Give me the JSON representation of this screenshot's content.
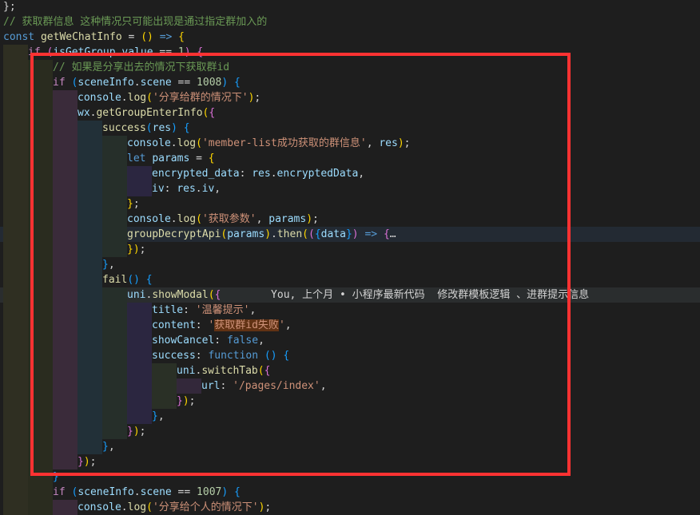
{
  "lines": [
    {
      "indent": 0,
      "cls": "",
      "tokens": [
        {
          "t": "pun",
          "s": "};"
        }
      ]
    },
    {
      "indent": 0,
      "cls": "",
      "tokens": [
        {
          "t": "cmt",
          "s": "// 获取群信息 这种情况只可能出现是通过指定群加入的"
        }
      ]
    },
    {
      "indent": 0,
      "cls": "",
      "tokens": [
        {
          "t": "kw",
          "s": "const "
        },
        {
          "t": "fn",
          "s": "getWeChatInfo"
        },
        {
          "t": "pun",
          "s": " = "
        },
        {
          "t": "br1",
          "s": "()"
        },
        {
          "t": "pun",
          "s": " "
        },
        {
          "t": "kw",
          "s": "=>"
        },
        {
          "t": "pun",
          "s": " "
        },
        {
          "t": "br1",
          "s": "{"
        }
      ]
    },
    {
      "indent": 1,
      "cls": "",
      "tokens": [
        {
          "t": "ctl",
          "s": "if "
        },
        {
          "t": "br2",
          "s": "("
        },
        {
          "t": "var",
          "s": "isGetGroup"
        },
        {
          "t": "pun",
          "s": "."
        },
        {
          "t": "var",
          "s": "value"
        },
        {
          "t": "pun",
          "s": " == "
        },
        {
          "t": "num",
          "s": "1"
        },
        {
          "t": "br2",
          "s": ")"
        },
        {
          "t": "pun",
          "s": " "
        },
        {
          "t": "br2",
          "s": "{"
        }
      ]
    },
    {
      "indent": 2,
      "cls": "",
      "tokens": [
        {
          "t": "cmt",
          "s": "// 如果是分享出去的情况下获取群id"
        }
      ]
    },
    {
      "indent": 2,
      "cls": "",
      "tokens": [
        {
          "t": "ctl",
          "s": "if "
        },
        {
          "t": "br3",
          "s": "("
        },
        {
          "t": "var",
          "s": "sceneInfo"
        },
        {
          "t": "pun",
          "s": "."
        },
        {
          "t": "var",
          "s": "scene"
        },
        {
          "t": "pun",
          "s": " == "
        },
        {
          "t": "num",
          "s": "1008"
        },
        {
          "t": "br3",
          "s": ")"
        },
        {
          "t": "pun",
          "s": " "
        },
        {
          "t": "br3",
          "s": "{"
        }
      ]
    },
    {
      "indent": 3,
      "cls": "",
      "tokens": [
        {
          "t": "var",
          "s": "console"
        },
        {
          "t": "pun",
          "s": "."
        },
        {
          "t": "fn",
          "s": "log"
        },
        {
          "t": "br1",
          "s": "("
        },
        {
          "t": "str",
          "s": "'分享给群的情况下'"
        },
        {
          "t": "br1",
          "s": ")"
        },
        {
          "t": "pun",
          "s": ";"
        }
      ]
    },
    {
      "indent": 3,
      "cls": "",
      "tokens": [
        {
          "t": "var",
          "s": "wx"
        },
        {
          "t": "pun",
          "s": "."
        },
        {
          "t": "fn",
          "s": "getGroupEnterInfo"
        },
        {
          "t": "br1",
          "s": "("
        },
        {
          "t": "br2",
          "s": "{"
        }
      ]
    },
    {
      "indent": 4,
      "cls": "",
      "tokens": [
        {
          "t": "fn",
          "s": "success"
        },
        {
          "t": "br3",
          "s": "("
        },
        {
          "t": "var",
          "s": "res"
        },
        {
          "t": "br3",
          "s": ")"
        },
        {
          "t": "pun",
          "s": " "
        },
        {
          "t": "br3",
          "s": "{"
        }
      ]
    },
    {
      "indent": 5,
      "cls": "",
      "tokens": [
        {
          "t": "var",
          "s": "console"
        },
        {
          "t": "pun",
          "s": "."
        },
        {
          "t": "fn",
          "s": "log"
        },
        {
          "t": "br1",
          "s": "("
        },
        {
          "t": "str",
          "s": "'member-list成功获取的群信息'"
        },
        {
          "t": "pun",
          "s": ", "
        },
        {
          "t": "var",
          "s": "res"
        },
        {
          "t": "br1",
          "s": ")"
        },
        {
          "t": "pun",
          "s": ";"
        }
      ]
    },
    {
      "indent": 5,
      "cls": "",
      "tokens": [
        {
          "t": "kw",
          "s": "let "
        },
        {
          "t": "var",
          "s": "params"
        },
        {
          "t": "pun",
          "s": " = "
        },
        {
          "t": "br1",
          "s": "{"
        }
      ]
    },
    {
      "indent": 6,
      "cls": "",
      "tokens": [
        {
          "t": "var",
          "s": "encrypted_data"
        },
        {
          "t": "pun",
          "s": ": "
        },
        {
          "t": "var",
          "s": "res"
        },
        {
          "t": "pun",
          "s": "."
        },
        {
          "t": "var",
          "s": "encryptedData"
        },
        {
          "t": "pun",
          "s": ","
        }
      ]
    },
    {
      "indent": 6,
      "cls": "",
      "tokens": [
        {
          "t": "var",
          "s": "iv"
        },
        {
          "t": "pun",
          "s": ": "
        },
        {
          "t": "var",
          "s": "res"
        },
        {
          "t": "pun",
          "s": "."
        },
        {
          "t": "var",
          "s": "iv"
        },
        {
          "t": "pun",
          "s": ","
        }
      ]
    },
    {
      "indent": 5,
      "cls": "",
      "tokens": [
        {
          "t": "br1",
          "s": "}"
        },
        {
          "t": "pun",
          "s": ";"
        }
      ]
    },
    {
      "indent": 5,
      "cls": "",
      "tokens": [
        {
          "t": "var",
          "s": "console"
        },
        {
          "t": "pun",
          "s": "."
        },
        {
          "t": "fn",
          "s": "log"
        },
        {
          "t": "br1",
          "s": "("
        },
        {
          "t": "str",
          "s": "'获取参数'"
        },
        {
          "t": "pun",
          "s": ", "
        },
        {
          "t": "var",
          "s": "params"
        },
        {
          "t": "br1",
          "s": ")"
        },
        {
          "t": "pun",
          "s": ";"
        }
      ]
    },
    {
      "indent": 5,
      "cls": "hl2",
      "tokens": [
        {
          "t": "fn",
          "s": "groupDecryptApi"
        },
        {
          "t": "br1",
          "s": "("
        },
        {
          "t": "var",
          "s": "params"
        },
        {
          "t": "br1",
          "s": ")"
        },
        {
          "t": "pun",
          "s": "."
        },
        {
          "t": "fn",
          "s": "then"
        },
        {
          "t": "br1",
          "s": "("
        },
        {
          "t": "br2",
          "s": "("
        },
        {
          "t": "br3",
          "s": "{"
        },
        {
          "t": "var",
          "s": "data"
        },
        {
          "t": "br3",
          "s": "}"
        },
        {
          "t": "br2",
          "s": ")"
        },
        {
          "t": "pun",
          "s": " "
        },
        {
          "t": "kw",
          "s": "=>"
        },
        {
          "t": "pun",
          "s": " "
        },
        {
          "t": "br2",
          "s": "{"
        },
        {
          "t": "fold",
          "s": "…"
        }
      ]
    },
    {
      "indent": 5,
      "cls": "",
      "tokens": [
        {
          "t": "br1",
          "s": "}"
        },
        {
          "t": "br1",
          "s": ")"
        },
        {
          "t": "pun",
          "s": ";"
        }
      ]
    },
    {
      "indent": 4,
      "cls": "",
      "tokens": [
        {
          "t": "br3",
          "s": "}"
        },
        {
          "t": "pun",
          "s": ","
        }
      ]
    },
    {
      "indent": 4,
      "cls": "",
      "tokens": [
        {
          "t": "fn",
          "s": "fail"
        },
        {
          "t": "br3",
          "s": "()"
        },
        {
          "t": "pun",
          "s": " "
        },
        {
          "t": "br3",
          "s": "{"
        }
      ]
    },
    {
      "indent": 5,
      "cls": "hl",
      "tokens": [
        {
          "t": "var",
          "s": "uni"
        },
        {
          "t": "pun",
          "s": "."
        },
        {
          "t": "fn",
          "s": "showModal"
        },
        {
          "t": "br1",
          "s": "("
        },
        {
          "t": "br2",
          "s": "{"
        },
        {
          "t": "ghost",
          "s": "        You, 上个月 • 小程序最新代码  修改群模板逻辑 、进群提示信息"
        }
      ]
    },
    {
      "indent": 6,
      "cls": "",
      "tokens": [
        {
          "t": "var",
          "s": "title"
        },
        {
          "t": "pun",
          "s": ": "
        },
        {
          "t": "str",
          "s": "'温馨提示'"
        },
        {
          "t": "pun",
          "s": ","
        }
      ]
    },
    {
      "indent": 6,
      "cls": "",
      "tokens": [
        {
          "t": "var",
          "s": "content"
        },
        {
          "t": "pun",
          "s": ": "
        },
        {
          "t": "str",
          "s": "'"
        },
        {
          "t": "strhl",
          "s": "获取群id失败"
        },
        {
          "t": "str",
          "s": "'"
        },
        {
          "t": "pun",
          "s": ","
        }
      ]
    },
    {
      "indent": 6,
      "cls": "",
      "tokens": [
        {
          "t": "var",
          "s": "showCancel"
        },
        {
          "t": "pun",
          "s": ": "
        },
        {
          "t": "kw",
          "s": "false"
        },
        {
          "t": "pun",
          "s": ","
        }
      ]
    },
    {
      "indent": 6,
      "cls": "",
      "tokens": [
        {
          "t": "var",
          "s": "success"
        },
        {
          "t": "pun",
          "s": ": "
        },
        {
          "t": "kw",
          "s": "function "
        },
        {
          "t": "br3",
          "s": "()"
        },
        {
          "t": "pun",
          "s": " "
        },
        {
          "t": "br3",
          "s": "{"
        }
      ]
    },
    {
      "indent": 7,
      "cls": "",
      "tokens": [
        {
          "t": "var",
          "s": "uni"
        },
        {
          "t": "pun",
          "s": "."
        },
        {
          "t": "fn",
          "s": "switchTab"
        },
        {
          "t": "br1",
          "s": "("
        },
        {
          "t": "br2",
          "s": "{"
        }
      ]
    },
    {
      "indent": 8,
      "cls": "",
      "tokens": [
        {
          "t": "var",
          "s": "url"
        },
        {
          "t": "pun",
          "s": ": "
        },
        {
          "t": "str",
          "s": "'/pages/index'"
        },
        {
          "t": "pun",
          "s": ","
        }
      ]
    },
    {
      "indent": 7,
      "cls": "",
      "tokens": [
        {
          "t": "br2",
          "s": "}"
        },
        {
          "t": "br1",
          "s": ")"
        },
        {
          "t": "pun",
          "s": ";"
        }
      ]
    },
    {
      "indent": 6,
      "cls": "",
      "tokens": [
        {
          "t": "br3",
          "s": "}"
        },
        {
          "t": "pun",
          "s": ","
        }
      ]
    },
    {
      "indent": 5,
      "cls": "",
      "tokens": [
        {
          "t": "br2",
          "s": "}"
        },
        {
          "t": "br1",
          "s": ")"
        },
        {
          "t": "pun",
          "s": ";"
        }
      ]
    },
    {
      "indent": 4,
      "cls": "",
      "tokens": [
        {
          "t": "br3",
          "s": "}"
        },
        {
          "t": "pun",
          "s": ","
        }
      ]
    },
    {
      "indent": 3,
      "cls": "",
      "tokens": [
        {
          "t": "br2",
          "s": "}"
        },
        {
          "t": "br1",
          "s": ")"
        },
        {
          "t": "pun",
          "s": ";"
        }
      ]
    },
    {
      "indent": 2,
      "cls": "",
      "tokens": [
        {
          "t": "br3",
          "s": "}"
        }
      ]
    },
    {
      "indent": 2,
      "cls": "",
      "tokens": [
        {
          "t": "ctl",
          "s": "if "
        },
        {
          "t": "br3",
          "s": "("
        },
        {
          "t": "var",
          "s": "sceneInfo"
        },
        {
          "t": "pun",
          "s": "."
        },
        {
          "t": "var",
          "s": "scene"
        },
        {
          "t": "pun",
          "s": " == "
        },
        {
          "t": "num",
          "s": "1007"
        },
        {
          "t": "br3",
          "s": ")"
        },
        {
          "t": "pun",
          "s": " "
        },
        {
          "t": "br3",
          "s": "{"
        }
      ]
    },
    {
      "indent": 3,
      "cls": "",
      "tokens": [
        {
          "t": "var",
          "s": "console"
        },
        {
          "t": "pun",
          "s": "."
        },
        {
          "t": "fn",
          "s": "log"
        },
        {
          "t": "br1",
          "s": "("
        },
        {
          "t": "str",
          "s": "'分享给个人的情况下'"
        },
        {
          "t": "br1",
          "s": ")"
        },
        {
          "t": "pun",
          "s": ";"
        }
      ]
    }
  ],
  "colors": {
    "background": "#1e1e1e",
    "highlight_box": "#ff3232",
    "indent_guides": [
      "#2f2f22",
      "#2a2c1f",
      "#3a2b3a",
      "#223038",
      "#262f2a",
      "#2b2640",
      "#2a3026",
      "#33283a"
    ]
  }
}
